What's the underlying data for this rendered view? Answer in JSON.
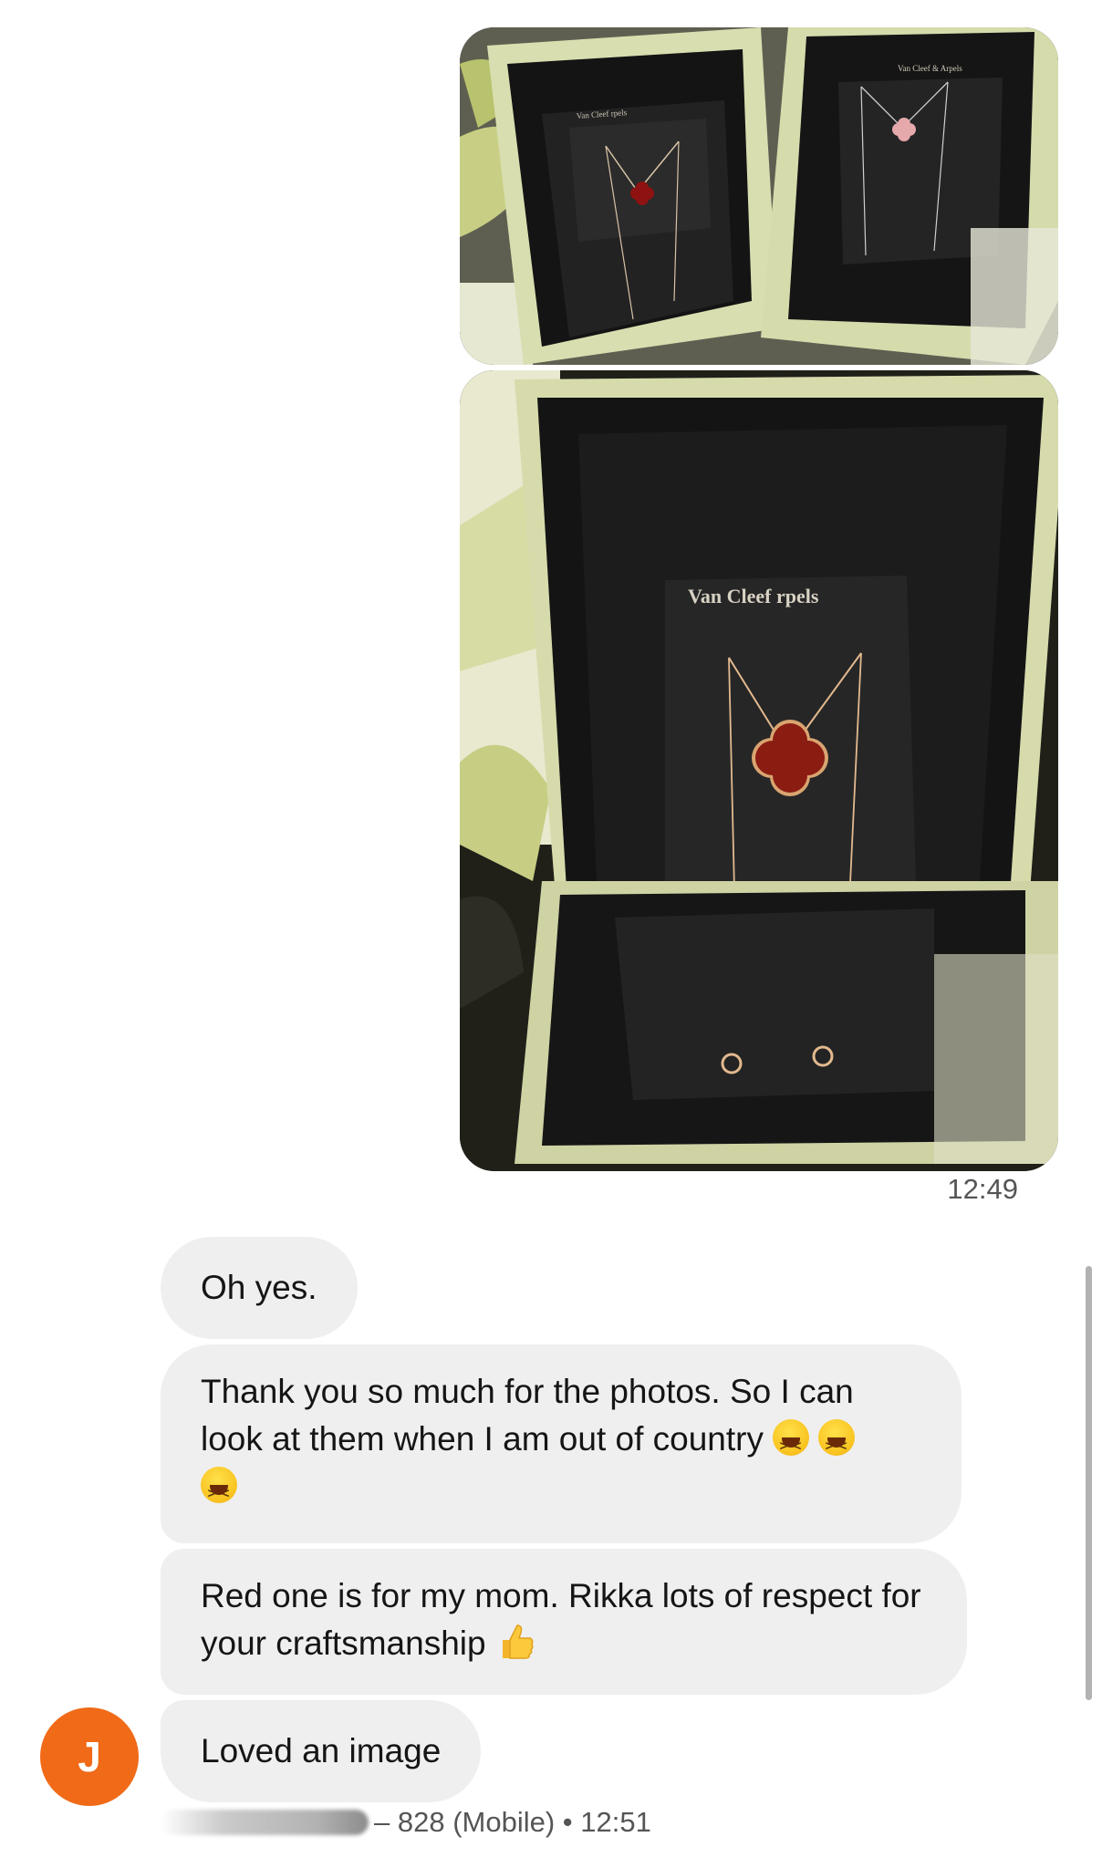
{
  "sent": {
    "photos": [
      {
        "description_icon": "photo-two-necklace-boxes",
        "box_label_left": "Van Cleef   rpels",
        "box_label_right": "Van Cleef & Arpels"
      },
      {
        "description_icon": "photo-red-clover-necklace",
        "box_label": "Van Cleef    rpels"
      }
    ],
    "time": "12:49"
  },
  "messages": [
    {
      "text": "Oh yes."
    },
    {
      "text": "Thank you so much for the photos. So I can look at them when I am out of country",
      "emojis": [
        "laughing-emoji",
        "laughing-emoji",
        "laughing-emoji"
      ]
    },
    {
      "text": "Red one is for my mom. Rikka lots of respect for your craftsmanship",
      "emojis": [
        "thumbs-up-emoji"
      ]
    },
    {
      "text": "Loved an image"
    }
  ],
  "sender": {
    "avatar_initial": "J",
    "avatar_color": "#f06a18",
    "number_suffix": "– 828 (Mobile)",
    "separator": "•",
    "time": "12:51"
  }
}
